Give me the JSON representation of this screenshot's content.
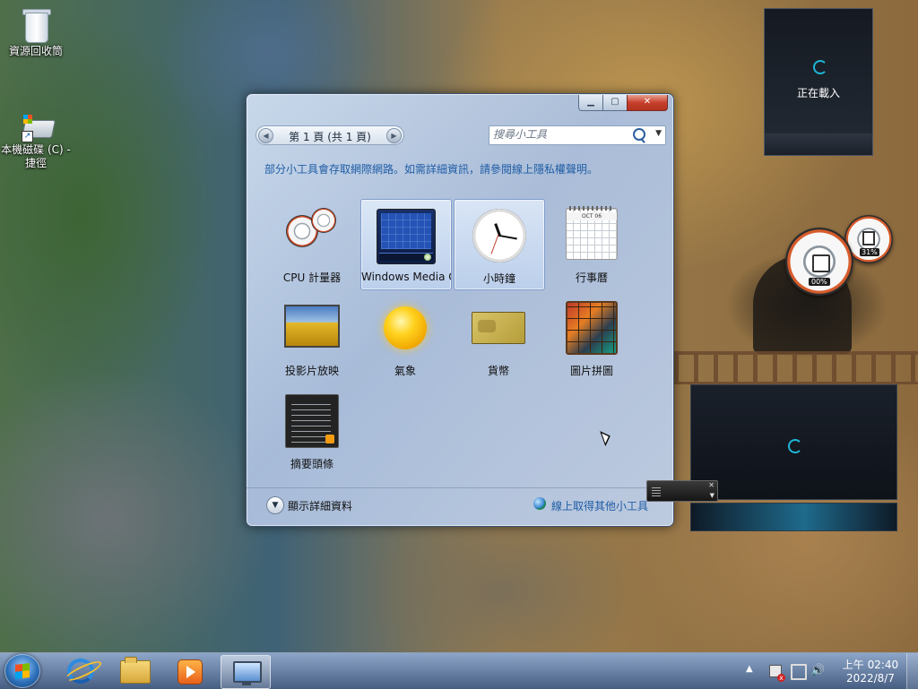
{
  "desktop": {
    "icons": [
      {
        "label": "資源回收筒"
      },
      {
        "label": "本機磁碟 (C) - 捷徑"
      }
    ]
  },
  "gallery": {
    "pager_text": "第 1 頁 (共 1 頁)",
    "search_placeholder": "搜尋小工具",
    "privacy_notice": "部分小工具會存取網際網路。如需詳細資訊，請參閱線上隱私權聲明。",
    "gadgets": [
      {
        "label": "CPU 計量器"
      },
      {
        "label": "Windows Media Center"
      },
      {
        "label": "小時鐘"
      },
      {
        "label": "行事曆"
      },
      {
        "label": "投影片放映"
      },
      {
        "label": "氣象"
      },
      {
        "label": "貨幣"
      },
      {
        "label": "圖片拼圖"
      },
      {
        "label": "摘要頭條"
      }
    ],
    "calendar_month": "OCT 06",
    "show_details_label": "顯示詳細資料",
    "get_more_label": "線上取得其他小工具"
  },
  "sidebar": {
    "loading_text": "正在載入",
    "cpu_big_percent": "00%",
    "cpu_small_percent": "31%"
  },
  "taskbar": {
    "clock_time": "上午 02:40",
    "clock_date": "2022/8/7"
  }
}
